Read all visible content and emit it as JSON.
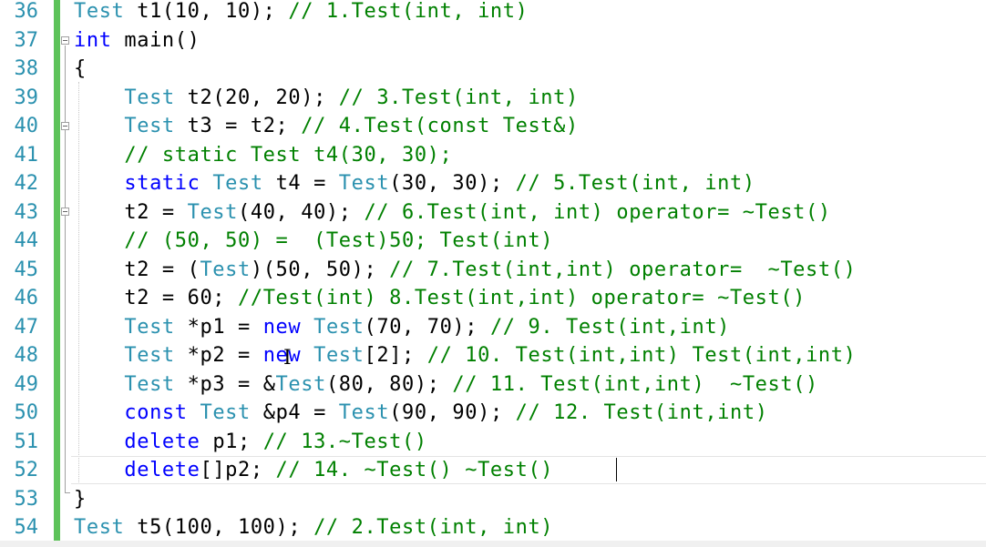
{
  "editor": {
    "line_numbers": [
      "36",
      "37",
      "38",
      "39",
      "40",
      "41",
      "42",
      "43",
      "44",
      "45",
      "46",
      "47",
      "48",
      "49",
      "50",
      "51",
      "52",
      "53",
      "54"
    ],
    "lines": [
      [
        {
          "t": "Test",
          "c": "ty"
        },
        {
          "t": " t1(10, 10); "
        },
        {
          "t": "// 1.Test(int, int)",
          "c": "cm"
        }
      ],
      [
        {
          "t": "int",
          "c": "kw"
        },
        {
          "t": " main()"
        }
      ],
      [
        {
          "t": "{"
        }
      ],
      [
        {
          "t": "    "
        },
        {
          "t": "Test",
          "c": "ty"
        },
        {
          "t": " t2(20, 20); "
        },
        {
          "t": "// 3.Test(int, int)",
          "c": "cm"
        }
      ],
      [
        {
          "t": "    "
        },
        {
          "t": "Test",
          "c": "ty"
        },
        {
          "t": " t3 = t2; "
        },
        {
          "t": "// 4.Test(const Test&)",
          "c": "cm"
        }
      ],
      [
        {
          "t": "    "
        },
        {
          "t": "// static Test t4(30, 30);",
          "c": "cm"
        }
      ],
      [
        {
          "t": "    "
        },
        {
          "t": "static",
          "c": "kw"
        },
        {
          "t": " "
        },
        {
          "t": "Test",
          "c": "ty"
        },
        {
          "t": " t4 = "
        },
        {
          "t": "Test",
          "c": "ty"
        },
        {
          "t": "(30, 30); "
        },
        {
          "t": "// 5.Test(int, int)",
          "c": "cm"
        }
      ],
      [
        {
          "t": "    t2 = "
        },
        {
          "t": "Test",
          "c": "ty"
        },
        {
          "t": "(40, 40); "
        },
        {
          "t": "// 6.Test(int, int) operator= ~Test()",
          "c": "cm"
        }
      ],
      [
        {
          "t": "    "
        },
        {
          "t": "// (50, 50) =  (Test)50; Test(int)",
          "c": "cm"
        }
      ],
      [
        {
          "t": "    t2 = ("
        },
        {
          "t": "Test",
          "c": "ty"
        },
        {
          "t": ")(50, 50); "
        },
        {
          "t": "// 7.Test(int,int) operator=  ~Test()",
          "c": "cm"
        }
      ],
      [
        {
          "t": "    t2 = 60; "
        },
        {
          "t": "//Test(int) 8.Test(int,int) operator= ~Test()",
          "c": "cm"
        }
      ],
      [
        {
          "t": "    "
        },
        {
          "t": "Test",
          "c": "ty"
        },
        {
          "t": " *p1 = "
        },
        {
          "t": "new",
          "c": "kw"
        },
        {
          "t": " "
        },
        {
          "t": "Test",
          "c": "ty"
        },
        {
          "t": "(70, 70); "
        },
        {
          "t": "// 9. Test(int,int)",
          "c": "cm"
        }
      ],
      [
        {
          "t": "    "
        },
        {
          "t": "Test",
          "c": "ty"
        },
        {
          "t": " *p2 = "
        },
        {
          "t": "new",
          "c": "kw"
        },
        {
          "t": " "
        },
        {
          "t": "Test",
          "c": "ty"
        },
        {
          "t": "[2]; "
        },
        {
          "t": "// 10. Test(int,int) Test(int,int)",
          "c": "cm"
        }
      ],
      [
        {
          "t": "    "
        },
        {
          "t": "Test",
          "c": "ty"
        },
        {
          "t": " *p3 = &"
        },
        {
          "t": "Test",
          "c": "ty"
        },
        {
          "t": "(80, 80); "
        },
        {
          "t": "// 11. Test(int,int)  ~Test()",
          "c": "cm"
        }
      ],
      [
        {
          "t": "    "
        },
        {
          "t": "const",
          "c": "kw"
        },
        {
          "t": " "
        },
        {
          "t": "Test",
          "c": "ty"
        },
        {
          "t": " &p4 = "
        },
        {
          "t": "Test",
          "c": "ty"
        },
        {
          "t": "(90, 90); "
        },
        {
          "t": "// 12. Test(int,int)",
          "c": "cm"
        }
      ],
      [
        {
          "t": "    "
        },
        {
          "t": "delete",
          "c": "kw"
        },
        {
          "t": " p1; "
        },
        {
          "t": "// 13.~Test()",
          "c": "cm"
        }
      ],
      [
        {
          "t": "    "
        },
        {
          "t": "delete",
          "c": "kw"
        },
        {
          "t": "[]p2; "
        },
        {
          "t": "// 14. ~Test() ~Test()",
          "c": "cm"
        }
      ],
      [
        {
          "t": "}"
        }
      ],
      [
        {
          "t": "Test",
          "c": "ty"
        },
        {
          "t": " t5(100, 100); "
        },
        {
          "t": "// 2.Test(int, int)",
          "c": "cm"
        }
      ]
    ]
  }
}
